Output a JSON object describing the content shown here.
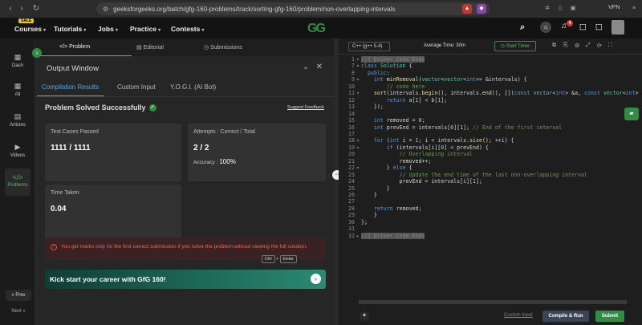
{
  "browser": {
    "url": "geeksforgeeks.org/batch/gfg-160-problems/track/sorting-gfg-160/problem/non-overlapping-intervals",
    "vpn_label": "VPN"
  },
  "site": {
    "sale_badge": "SALE",
    "menu": [
      "Courses",
      "Tutorials",
      "Jobs",
      "Practice",
      "Contests"
    ],
    "logo": "GG",
    "notification_count": "4"
  },
  "rail": {
    "items": [
      "Dash",
      "All",
      "Articles",
      "Videos",
      "Problems"
    ],
    "prev_label": "« Prev",
    "next_label": "Next »"
  },
  "left_tabs": [
    "Problem",
    "Editorial",
    "Submissions"
  ],
  "output": {
    "title": "Output Window",
    "subtabs": [
      "Compilation Results",
      "Custom Input",
      "Y.O.G.I. (AI Bot)"
    ],
    "status": "Problem Solved Successfully",
    "suggest_feedback": "Suggest Feedback",
    "test_cases_label": "Test Cases Passed",
    "test_cases_value": "1111 / 1111",
    "attempts_label": "Attempts : Correct / Total",
    "attempts_value": "2 / 2",
    "accuracy_label": "Accuracy :",
    "accuracy_value": "100%",
    "time_label": "Time Taken",
    "time_value": "0.04",
    "notice": "You get marks only for the first correct submission if you solve the problem without viewing the full solution.",
    "cta": "Kick start your career with GfG 160!"
  },
  "editor": {
    "language": "C++ (g++ 5.4)",
    "avg_time": "Average Time: 30m",
    "start_timer": "Start Timer",
    "custom_input_link": "Custom Input",
    "compile_button": "Compile & Run",
    "submit_button": "Submit",
    "kbd_ctrl": "Ctrl",
    "kbd_plus": "+",
    "kbd_enter": "Enter",
    "lines": [
      {
        "n": "1",
        "fold": "▾",
        "html": "<span class='hl'>//{ Driver Code Ends</span>"
      },
      {
        "n": "7",
        "fold": "▾",
        "html": "<span class='kw'>class</span> <span class='ty'>Solution</span> {"
      },
      {
        "n": "8",
        "fold": "",
        "html": "  <span class='kw'>public</span>:"
      },
      {
        "n": "9",
        "fold": "▾",
        "html": "    <span class='kw'>int</span> <span class='fn'>minRemoval</span>(<span class='ty'>vector</span>&lt;<span class='ty'>vector</span>&lt;<span class='kw'>int</span>&gt;&gt; &amp;intervals) {"
      },
      {
        "n": "10",
        "fold": "",
        "html": "        <span class='cm'>// code here</span>"
      },
      {
        "n": "11",
        "fold": "▾",
        "html": "    <span class='fn'>sort</span>(intervals.<span class='fn'>begin</span>(), intervals.<span class='fn'>end</span>(), [](<span class='kw'>const</span> <span class='ty'>vector</span>&lt;<span class='kw'>int</span>&gt; &amp;a, <span class='kw'>const</span> <span class='ty'>vector</span>&lt;<span class='kw'>int</span>&gt;"
      },
      {
        "n": "12",
        "fold": "",
        "html": "        <span class='kw'>return</span> a[<span class='num'>1</span>] &lt; b[<span class='num'>1</span>];"
      },
      {
        "n": "13",
        "fold": "",
        "html": "    });"
      },
      {
        "n": "14",
        "fold": "",
        "html": ""
      },
      {
        "n": "15",
        "fold": "",
        "html": "    <span class='kw'>int</span> removed = <span class='num'>0</span>;"
      },
      {
        "n": "16",
        "fold": "",
        "html": "    <span class='kw'>int</span> prevEnd = intervals[<span class='num'>0</span>][<span class='num'>1</span>]; <span class='cm'>// End of the first interval</span>"
      },
      {
        "n": "17",
        "fold": "",
        "html": ""
      },
      {
        "n": "18",
        "fold": "▾",
        "html": "    <span class='kw'>for</span> (<span class='kw'>int</span> i = <span class='num'>1</span>; i &lt; intervals.<span class='fn'>size</span>(); ++i) {"
      },
      {
        "n": "19",
        "fold": "▾",
        "html": "        <span class='kw'>if</span> (intervals[i][<span class='num'>0</span>] &lt; prevEnd) {"
      },
      {
        "n": "20",
        "fold": "",
        "html": "            <span class='cm'>// Overlapping interval</span>"
      },
      {
        "n": "21",
        "fold": "",
        "html": "            removed++;"
      },
      {
        "n": "22",
        "fold": "▾",
        "html": "        } <span class='kw'>else</span> {"
      },
      {
        "n": "23",
        "fold": "",
        "html": "            <span class='cm'>// Update the end time of the last non-overlapping interval</span>"
      },
      {
        "n": "24",
        "fold": "",
        "html": "            prevEnd = intervals[i][<span class='num'>1</span>];"
      },
      {
        "n": "25",
        "fold": "",
        "html": "        }"
      },
      {
        "n": "26",
        "fold": "",
        "html": "    }"
      },
      {
        "n": "27",
        "fold": "",
        "html": ""
      },
      {
        "n": "28",
        "fold": "",
        "html": "    <span class='kw'>return</span> removed;"
      },
      {
        "n": "29",
        "fold": "",
        "html": "    }"
      },
      {
        "n": "30",
        "fold": "",
        "html": "};"
      },
      {
        "n": "31",
        "fold": "",
        "html": ""
      },
      {
        "n": "32",
        "fold": "▸",
        "html": "<span class='hl'>//{ Driver Code Ends</span>"
      }
    ]
  }
}
